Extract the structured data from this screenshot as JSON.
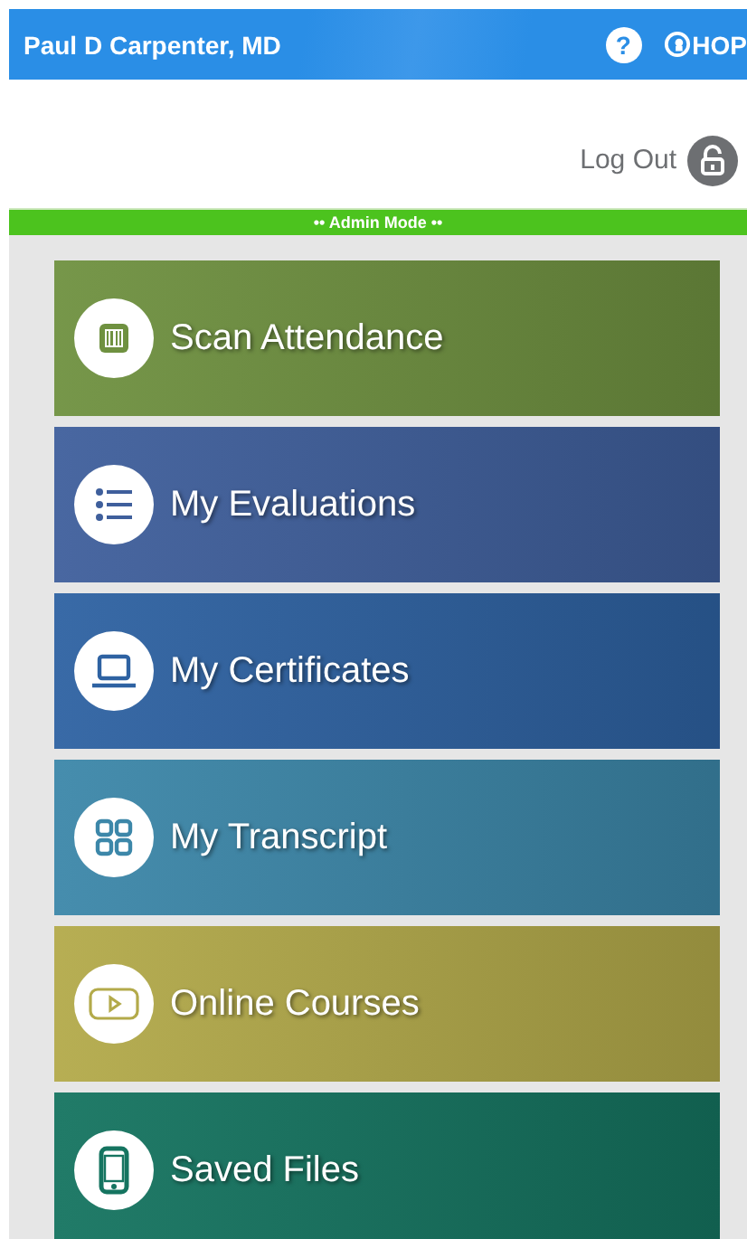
{
  "header": {
    "user_name": "Paul D Carpenter, MD",
    "help": "?",
    "logo_text": "HOP"
  },
  "logout": {
    "label": "Log Out"
  },
  "mode_banner": "•• Admin Mode ••",
  "tiles": [
    {
      "label": "Scan Attendance",
      "kind": "barcode",
      "color": "#6f9140"
    },
    {
      "label": "My Evaluations",
      "kind": "list",
      "color": "#3f5f9c"
    },
    {
      "label": "My Certificates",
      "kind": "laptop",
      "color": "#2e62a2"
    },
    {
      "label": "My Transcript",
      "kind": "grid",
      "color": "#3c87a9"
    },
    {
      "label": "Online Courses",
      "kind": "play",
      "color": "#b3aa4a"
    },
    {
      "label": "Saved Files",
      "kind": "phone",
      "color": "#157460"
    }
  ]
}
